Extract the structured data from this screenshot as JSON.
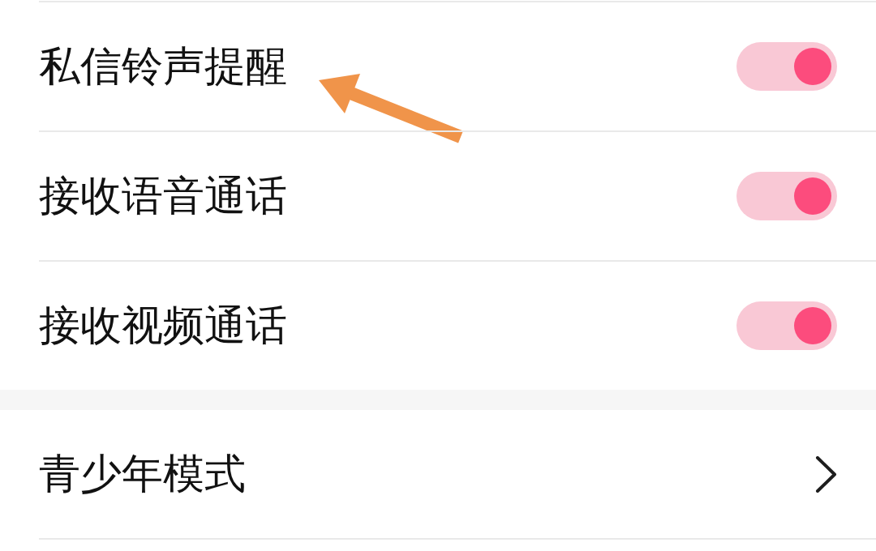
{
  "groups": [
    {
      "items": [
        {
          "kind": "toggle",
          "label": "私信铃声提醒",
          "on": true,
          "arrow": true
        },
        {
          "kind": "toggle",
          "label": "接收语音通话",
          "on": true,
          "arrow": false
        },
        {
          "kind": "toggle",
          "label": "接收视频通话",
          "on": true,
          "arrow": false
        }
      ]
    },
    {
      "items": [
        {
          "kind": "link",
          "label": "青少年模式",
          "arrow": false
        }
      ]
    }
  ]
}
